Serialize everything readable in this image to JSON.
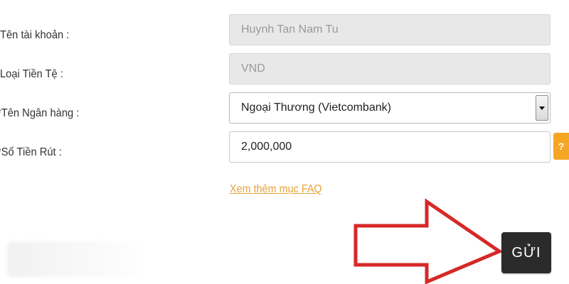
{
  "form": {
    "account_name_label": "Tên tài khoản :",
    "currency_label": "Loại Tiền Tệ :",
    "bank_name_label": "*Tên Ngân hàng :",
    "amount_label": "*Số Tiền Rút :",
    "account_name_value": "Huynh Tan Nam Tu",
    "currency_value": "VND",
    "bank_name_value": "Ngoại Thương (Vietcombank)",
    "amount_value": "2,000,000",
    "help_label": "?",
    "faq_link": "Xem thêm mục FAQ",
    "submit_label": "GỬI"
  },
  "colors": {
    "accent": "#f5a623",
    "link": "#e8a33a",
    "arrow": "#d62828",
    "submit_bg": "#2b2b2b"
  },
  "icons": {
    "dropdown": "chevron-down-icon",
    "help": "question-icon",
    "pointer": "arrow-right-icon"
  }
}
